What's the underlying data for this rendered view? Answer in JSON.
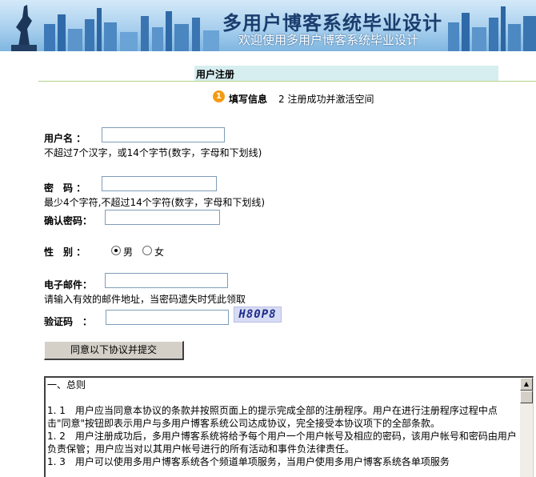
{
  "header": {
    "title": "多用户博客系统毕业设计",
    "subtitle": "欢迎使用多用户博客系统毕业设计"
  },
  "section": {
    "title": "用户注册"
  },
  "steps": {
    "current_number": "1",
    "current_label": "填写信息",
    "next_label": "2 注册成功并激活空间"
  },
  "form": {
    "username": {
      "label": "用户名 ：",
      "value": "",
      "hint": "不超过7个汉字，或14个字节(数字，字母和下划线)"
    },
    "password": {
      "label": "密　码 ：",
      "value": "",
      "hint": "最少4个字符,不超过14个字符(数字，字母和下划线)"
    },
    "confirm_password": {
      "label": "确认密码：",
      "value": ""
    },
    "gender": {
      "label": "性　别 ：",
      "options": [
        {
          "label": "男",
          "selected": true
        },
        {
          "label": "女",
          "selected": false
        }
      ]
    },
    "email": {
      "label": "电子邮件：",
      "value": "",
      "hint": "请输入有效的邮件地址，当密码遗失时凭此领取"
    },
    "captcha": {
      "label": "验证码　：",
      "value": "",
      "image_text": "H80P8"
    },
    "submit_label": "同意以下协议并提交"
  },
  "agreement": {
    "heading": "一、总则",
    "items": [
      "1. 1　用户应当同意本协议的条款并按照页面上的提示完成全部的注册程序。用户在进行注册程序过程中点击\"同意\"按钮即表示用户与多用户博客系统公司达成协议，完全接受本协议项下的全部条款。",
      "1. 2　用户注册成功后，多用户博客系统将给予每个用户一个用户帐号及相应的密码，该用户帐号和密码由用户负责保管；用户应当对以其用户帐号进行的所有活动和事件负法律责任。",
      "1. 3　用户可以使用多用户博客系统各个频道单项服务，当用户使用多用户博客系统各单项服务"
    ]
  },
  "colors": {
    "banner_top": "#d4e9f8",
    "section_bar": "#d7eef0",
    "step_badge": "#f39b12",
    "button_face": "#d4d0c8"
  }
}
